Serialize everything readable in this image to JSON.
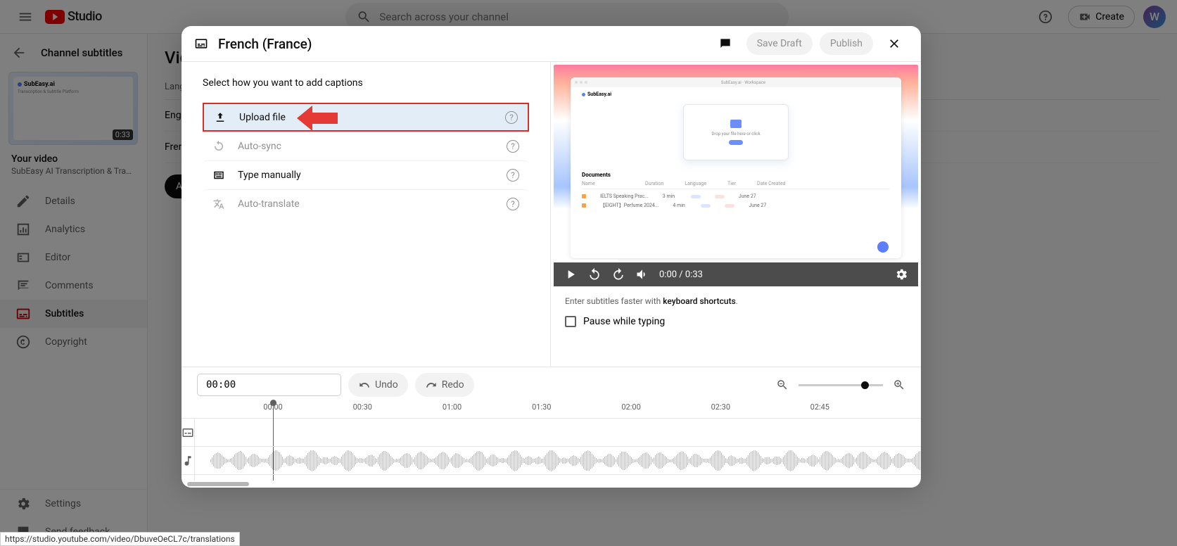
{
  "header": {
    "search_placeholder": "Search across your channel",
    "create_label": "Create"
  },
  "sidebar": {
    "back_label": "Channel subtitles",
    "video_title": "Your video",
    "video_subtitle": "SubEasy AI Transcription & Translati...",
    "video_duration": "0:33",
    "thumb_brand": "SubEasy.ai",
    "thumb_tagline": "Transcription & Subtitle Platform",
    "nav": [
      {
        "label": "Details",
        "icon": "pencil"
      },
      {
        "label": "Analytics",
        "icon": "chart"
      },
      {
        "label": "Editor",
        "icon": "editor"
      },
      {
        "label": "Comments",
        "icon": "comments"
      },
      {
        "label": "Subtitles",
        "icon": "subtitles",
        "active": true
      },
      {
        "label": "Copyright",
        "icon": "copyright"
      }
    ],
    "bottom": [
      {
        "label": "Settings",
        "icon": "gear"
      },
      {
        "label": "Send feedback",
        "icon": "feedback"
      }
    ]
  },
  "page": {
    "title": "Vid",
    "table_header": "Language",
    "rows": [
      "English",
      "French"
    ],
    "add_button": "Add"
  },
  "modal": {
    "title": "French (France)",
    "save_draft": "Save Draft",
    "publish": "Publish",
    "instruction": "Select how you want to add captions",
    "options": [
      {
        "label": "Upload file",
        "icon": "upload",
        "state": "highlighted"
      },
      {
        "label": "Auto-sync",
        "icon": "sync",
        "state": "disabled"
      },
      {
        "label": "Type manually",
        "icon": "keyboard",
        "state": "normal"
      },
      {
        "label": "Auto-translate",
        "icon": "translate",
        "state": "disabled"
      }
    ],
    "player": {
      "current_time": "0:00",
      "duration": "0:33",
      "hint_prefix": "Enter subtitles faster with ",
      "hint_bold": "keyboard shortcuts",
      "pause_label": "Pause while typing",
      "preview_app": "SubEasy.ai",
      "preview_section": "Documents"
    },
    "timeline": {
      "time": "00:00",
      "undo": "Undo",
      "redo": "Redo",
      "ticks": [
        "00:00",
        "00:30",
        "01:00",
        "01:30",
        "02:00",
        "02:30",
        "02:45"
      ]
    }
  },
  "status_url": "https://studio.youtube.com/video/DbuveOeCL7c/translations"
}
